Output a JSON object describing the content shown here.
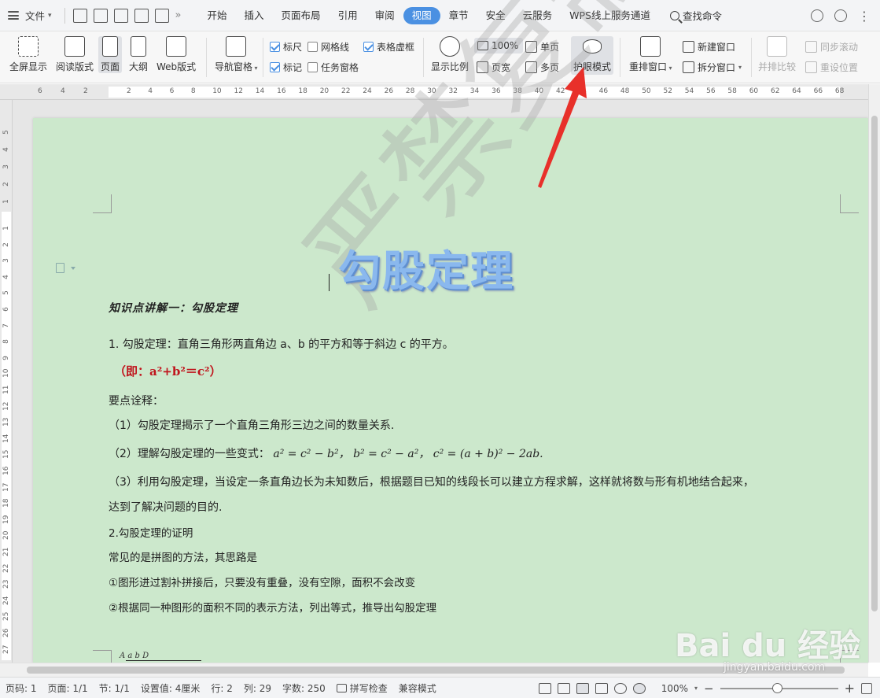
{
  "menubar": {
    "file_label": "文件",
    "tabs": [
      {
        "label": "开始"
      },
      {
        "label": "插入"
      },
      {
        "label": "页面布局"
      },
      {
        "label": "引用"
      },
      {
        "label": "审阅"
      },
      {
        "label": "视图"
      },
      {
        "label": "章节"
      },
      {
        "label": "安全"
      },
      {
        "label": "云服务"
      },
      {
        "label": "WPS线上服务通道"
      }
    ],
    "active_tab": "视图",
    "search_label": "查找命令"
  },
  "ribbon": {
    "fullscreen": "全屏显示",
    "reading": "阅读版式",
    "page": "页面",
    "outline": "大纲",
    "web": "Web版式",
    "nav_pane": "导航窗格",
    "ruler": "标尺",
    "gridlines": "网格线",
    "table_dotted": "表格虚框",
    "marks": "标记",
    "task_pane": "任务窗格",
    "zoom_ratio": "显示比例",
    "zoom_100": "100%",
    "page_width": "页宽",
    "single_page": "单页",
    "multi_page": "多页",
    "eye_mode": "护眼模式",
    "rearrange": "重排窗口",
    "new_window": "新建窗口",
    "split_window": "拆分窗口",
    "side_by_side": "并排比较",
    "sync_scroll": "同步滚动",
    "reset_pos": "重设位置"
  },
  "ruler": {
    "h_left": [
      "6",
      "4",
      "2"
    ],
    "h_right": [
      "2",
      "4",
      "6",
      "8",
      "10",
      "12",
      "14",
      "16",
      "18",
      "20",
      "22",
      "24",
      "26",
      "28",
      "30",
      "32",
      "34",
      "36",
      "38",
      "40",
      "42",
      "44",
      "46",
      "48",
      "50",
      "52",
      "54",
      "56",
      "58",
      "60",
      "62",
      "64",
      "66",
      "68"
    ],
    "v_top": [
      "5",
      "4",
      "3",
      "2",
      "1"
    ],
    "v_body": [
      "1",
      "2",
      "3",
      "4",
      "5",
      "6",
      "7",
      "8",
      "9",
      "10",
      "11",
      "12",
      "13",
      "14",
      "15",
      "16",
      "17",
      "18",
      "19",
      "20",
      "21",
      "22",
      "23",
      "24",
      "25",
      "26",
      "27"
    ]
  },
  "document": {
    "title": "勾股定理",
    "watermark": "严禁复制",
    "section_heading": "知识点讲解一：勾股定理",
    "line1": "1. 勾股定理：直角三角形两直角边 a、b 的平方和等于斜边 c 的平方。",
    "formula_red": "（即：a²+b²＝c²）",
    "key_points": "要点诠释：",
    "point1": "（1）勾股定理揭示了一个直角三角形三边之间的数量关系.",
    "point2_prefix": "（2）理解勾股定理的一些变式：",
    "point2_math": "a² = c² − b²，  b² = c² − a²，   c² = (a + b)² − 2ab.",
    "point3a": "（3）利用勾股定理，当设定一条直角边长为未知数后，根据题目已知的线段长可以建立方程求解，这样就将数与形有机地结合起来，",
    "point3b": "达到了解决问题的目的.",
    "proof_heading": "2.勾股定理的证明",
    "proof_intro": "常见的是拼图的方法，其思路是",
    "proof1": "①图形进过割补拼接后，只要没有重叠，没有空隙，面积不会改变",
    "proof2": "②根据同一种图形的面积不同的表示方法，列出等式，推导出勾股定理",
    "figure_labels": "A   a        b    D"
  },
  "statusbar": {
    "page_no": "页码: 1",
    "pages": "页面: 1/1",
    "section": "节: 1/1",
    "setting": "设置值: 4厘米",
    "row": "行: 2",
    "col": "列: 29",
    "words": "字数: 250",
    "spell": "拼写检查",
    "compat": "兼容模式",
    "zoom": "100%",
    "minus": "−",
    "plus": "+"
  },
  "watermark_site": {
    "logo": "Bai du 经验",
    "url": "jingyan.baidu.com"
  },
  "colors": {
    "accent": "#4a90e2",
    "page_green": "#cce8cc",
    "annotation_red": "#e8302a",
    "formula_red": "#c0141c"
  }
}
